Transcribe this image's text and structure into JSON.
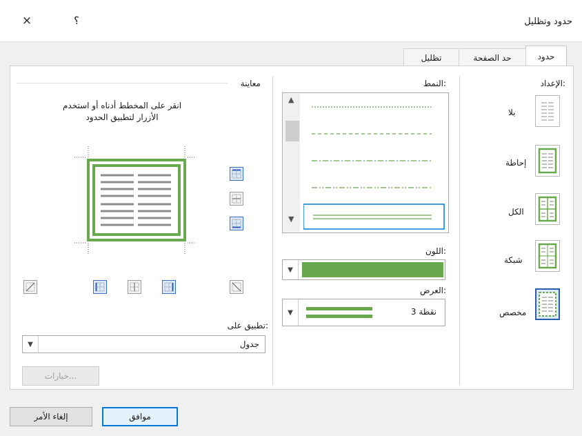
{
  "window": {
    "title": "حدود وتظليل",
    "help_label": "؟",
    "close_label": "×"
  },
  "tabs": [
    {
      "label": "حدود",
      "active": true
    },
    {
      "label": "حد الصفحة",
      "active": false
    },
    {
      "label": "تظليل",
      "active": false
    }
  ],
  "setting": {
    "heading": "الإعداد:",
    "items": [
      {
        "label": "بلا",
        "icon": "none-border-icon",
        "selected": false
      },
      {
        "label": "إحاطة",
        "icon": "box-border-icon",
        "selected": false
      },
      {
        "label": "الكل",
        "icon": "all-border-icon",
        "selected": false
      },
      {
        "label": "شبكة",
        "icon": "grid-border-icon",
        "selected": false
      },
      {
        "label": "مخصص",
        "icon": "custom-border-icon",
        "selected": true
      }
    ]
  },
  "style": {
    "heading": "النمط:",
    "styles": [
      "dotted",
      "dashed-small",
      "dash-dot",
      "dash-dot-dot",
      "double"
    ],
    "selected": "double"
  },
  "color": {
    "heading": "اللون:",
    "value": "#6aa84f"
  },
  "width": {
    "heading": "العرض:",
    "value": "3 نقطة"
  },
  "preview": {
    "heading": "معاينة",
    "instructions_line1": "انقر على المخطط أدناه أو استخدم",
    "instructions_line2": "الأزرار لتطبيق الحدود"
  },
  "apply_to": {
    "heading": "تطبيق على:",
    "value": "جدول"
  },
  "buttons": {
    "options": "خيارات...",
    "ok": "موافق",
    "cancel": "إلغاء الأمر"
  },
  "colors": {
    "accent": "#6aa84f",
    "selection": "#2a5db0"
  }
}
